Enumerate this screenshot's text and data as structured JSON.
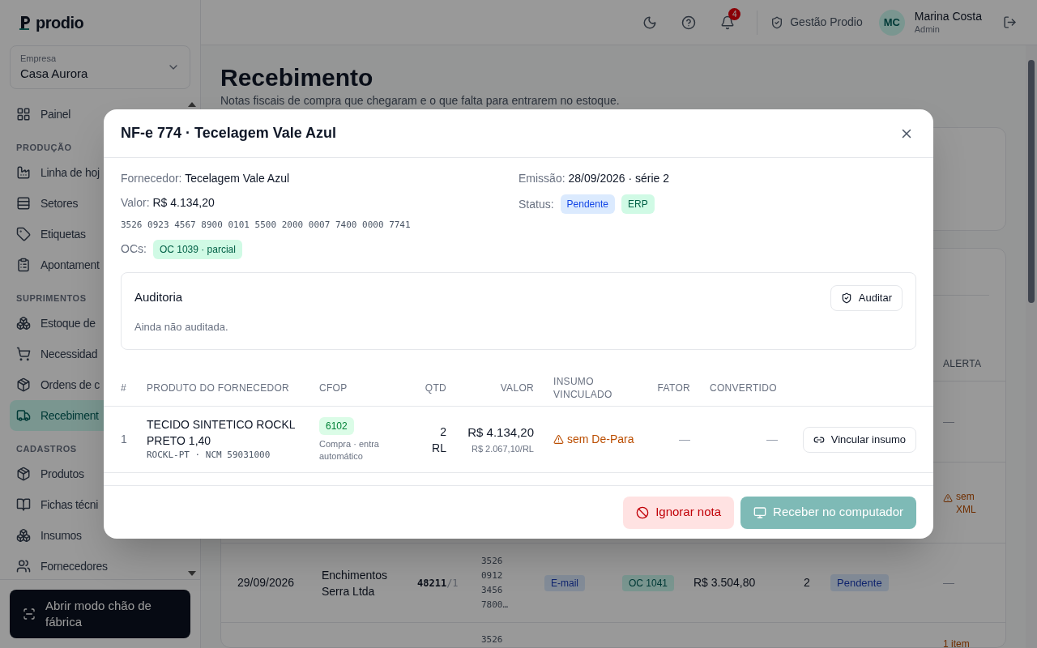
{
  "sidebar": {
    "logo": "prodio",
    "company": {
      "label": "Empresa",
      "value": "Casa Aurora"
    },
    "items": [
      {
        "kind": "link",
        "label": "Painel",
        "selected": false
      },
      {
        "kind": "section",
        "label": "PRODUÇÃO"
      },
      {
        "kind": "link",
        "label": "Linha de hoj",
        "selected": false
      },
      {
        "kind": "link",
        "label": "Setores",
        "selected": false
      },
      {
        "kind": "link",
        "label": "Etiquetas",
        "selected": false
      },
      {
        "kind": "link",
        "label": "Apontament",
        "selected": false
      },
      {
        "kind": "section",
        "label": "SUPRIMENTOS"
      },
      {
        "kind": "link",
        "label": "Estoque de",
        "selected": false
      },
      {
        "kind": "link",
        "label": "Necessidad",
        "selected": false
      },
      {
        "kind": "link",
        "label": "Ordens de c",
        "selected": false
      },
      {
        "kind": "link",
        "label": "Recebiment",
        "selected": true
      },
      {
        "kind": "section",
        "label": "CADASTROS"
      },
      {
        "kind": "link",
        "label": "Produtos",
        "selected": false
      },
      {
        "kind": "link",
        "label": "Fichas técni",
        "selected": false
      },
      {
        "kind": "link",
        "label": "Insumos",
        "selected": false
      },
      {
        "kind": "link",
        "label": "Fornecedores",
        "selected": false
      }
    ],
    "footer_button": "Abrir modo chão de fábrica"
  },
  "header": {
    "notifications": "4",
    "brand": "Gestão Prodio",
    "user": {
      "initials": "MC",
      "name": "Marina Costa",
      "role": "Admin"
    }
  },
  "page": {
    "title": "Recebimento",
    "subtitle": "Notas fiscais de compra que chegaram e o que falta para entrarem no estoque."
  },
  "table": {
    "columns": [
      {
        "label": "ALERTA"
      }
    ],
    "rows": [
      {
        "alert": {
          "kind": "none",
          "text": "—"
        }
      },
      {
        "alert": {
          "kind": "warning",
          "text": "sem XML"
        }
      },
      {
        "date": "29/09/2026",
        "supplier": "Enchimentos Serra Ltda",
        "number": "48211",
        "series": "/1",
        "key": "3526 0912 3456 7800…",
        "channel": "E-mail",
        "order": "OC 1041",
        "value": "R$ 3.504,80",
        "items": "2",
        "status": "Pendente",
        "alert": {
          "kind": "none",
          "text": "—"
        }
      },
      {
        "key": "3526",
        "alert": {
          "kind": "count",
          "text": "1 item"
        }
      }
    ]
  },
  "dialog": {
    "title": "NF-e 774 · Tecelagem Vale Azul",
    "supplier": {
      "label": "Fornecedor:",
      "value": "Tecelagem Vale Azul"
    },
    "amount": {
      "label": "Valor:",
      "value": "R$ 4.134,20"
    },
    "access_key": "3526 0923 4567 8900 0101 5500 2000 0007 7400 0000 7741",
    "orders": {
      "label": "OCs:",
      "tags": [
        "OC 1039 · parcial"
      ]
    },
    "issued": {
      "label": "Emissão:",
      "value": "28/09/2026 · série 2"
    },
    "status": {
      "label": "Status:",
      "badges": [
        {
          "kind": "status",
          "text": "Pendente"
        },
        {
          "kind": "source",
          "text": "ERP"
        }
      ]
    },
    "audit": {
      "title": "Auditoria",
      "button": "Auditar",
      "note": "Ainda não auditada."
    },
    "columns": [
      "#",
      "PRODUTO DO FORNECEDOR",
      "CFOP",
      "QTD",
      "VALOR",
      "INSUMO VINCULADO",
      "FATOR",
      "CONVERTIDO"
    ],
    "rows": [
      {
        "index": "1",
        "name": "TECIDO SINTETICO ROCKL PRETO 1,40",
        "code": "ROCKL-PT · NCM 59031000",
        "cfop": "6102",
        "cfop_note": "Compra · entra automático",
        "qty": "2 RL",
        "value": "R$ 4.134,20",
        "unit_value": "R$ 2.067,10/RL",
        "link": {
          "kind": "warning",
          "text": "sem De-Para"
        },
        "factor": "—",
        "converted": "—",
        "action": "Vincular insumo"
      }
    ],
    "ignore_button": "Ignorar nota",
    "receive_button": {
      "label": "Receber no computador",
      "disabled": true
    }
  }
}
